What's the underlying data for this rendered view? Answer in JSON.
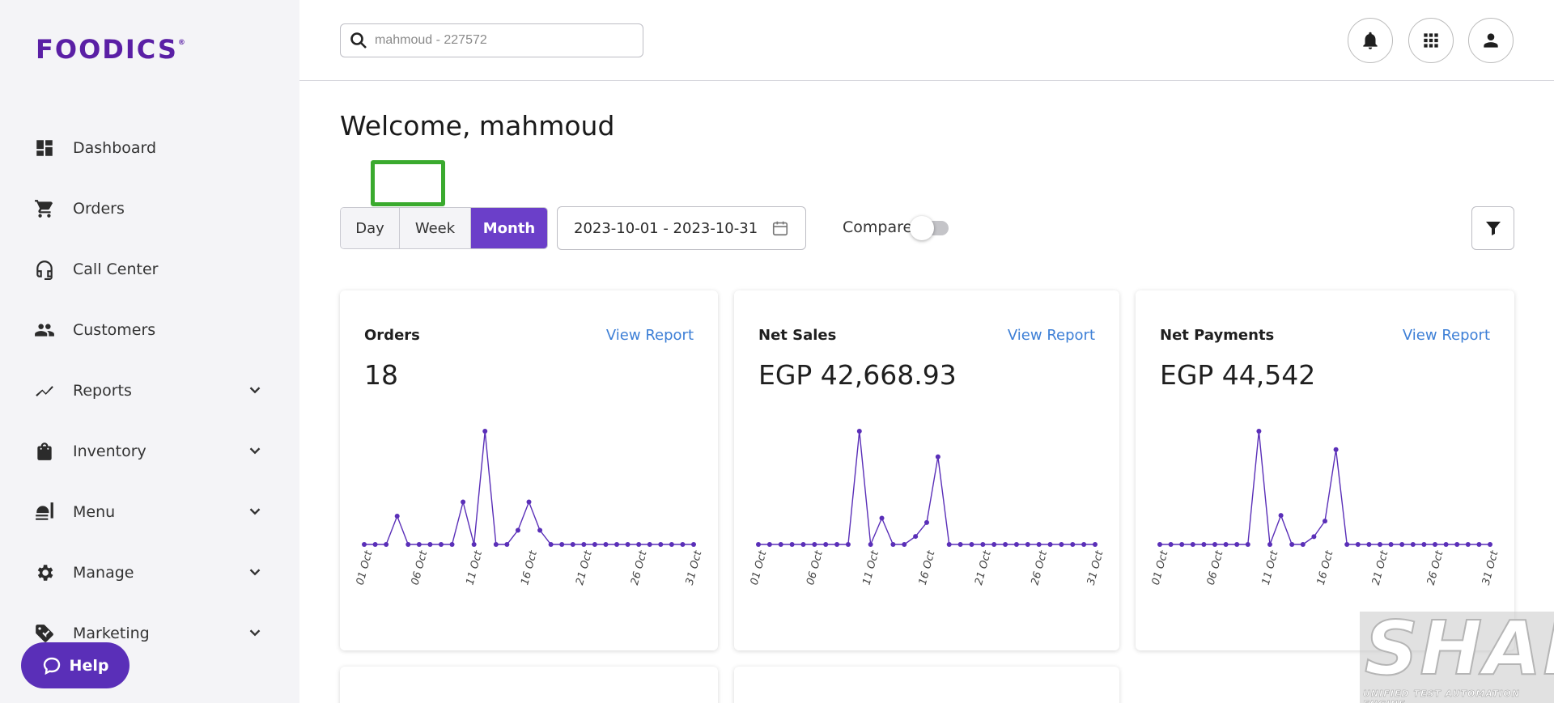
{
  "brand": {
    "logo_text": "FOODICS",
    "logo_mark": "®",
    "accent": "#6b3fc9"
  },
  "sidebar": {
    "items": [
      {
        "label": "Dashboard",
        "icon": "dashboard-icon",
        "expandable": false
      },
      {
        "label": "Orders",
        "icon": "cart-icon",
        "expandable": false
      },
      {
        "label": "Call Center",
        "icon": "headset-icon",
        "expandable": false
      },
      {
        "label": "Customers",
        "icon": "people-icon",
        "expandable": false
      },
      {
        "label": "Reports",
        "icon": "trend-icon",
        "expandable": true
      },
      {
        "label": "Inventory",
        "icon": "bag-icon",
        "expandable": true
      },
      {
        "label": "Menu",
        "icon": "menu-food-icon",
        "expandable": true
      },
      {
        "label": "Manage",
        "icon": "gear-icon",
        "expandable": true
      },
      {
        "label": "Marketing",
        "icon": "tag-icon",
        "expandable": true
      }
    ],
    "help_label": "Help"
  },
  "header": {
    "search_placeholder": "mahmoud - 227572"
  },
  "main": {
    "welcome": "Welcome, mahmoud",
    "period_tabs": [
      {
        "label": "Day",
        "active": false
      },
      {
        "label": "Week",
        "active": false
      },
      {
        "label": "Month",
        "active": true
      }
    ],
    "date_range": "2023-10-01 - 2023-10-31",
    "compare_label": "Compare",
    "compare_on": false,
    "cards": [
      {
        "title": "Orders",
        "link": "View Report",
        "value": "18"
      },
      {
        "title": "Net Sales",
        "link": "View Report",
        "value": "EGP 42,668.93"
      },
      {
        "title": "Net Payments",
        "link": "View Report",
        "value": "EGP 44,542"
      }
    ]
  },
  "watermark": {
    "title": "SHAFT",
    "subtitle": "UNIFIED TEST AUTOMATION ENGINE"
  },
  "chart_data": [
    {
      "type": "line",
      "title": "Orders",
      "x": [
        "01 Oct",
        "02 Oct",
        "03 Oct",
        "04 Oct",
        "05 Oct",
        "06 Oct",
        "07 Oct",
        "08 Oct",
        "09 Oct",
        "10 Oct",
        "11 Oct",
        "12 Oct",
        "13 Oct",
        "14 Oct",
        "15 Oct",
        "16 Oct",
        "17 Oct",
        "18 Oct",
        "19 Oct",
        "20 Oct",
        "21 Oct",
        "22 Oct",
        "23 Oct",
        "24 Oct",
        "25 Oct",
        "26 Oct",
        "27 Oct",
        "28 Oct",
        "29 Oct",
        "30 Oct",
        "31 Oct"
      ],
      "tick_labels": [
        "01 Oct",
        "06 Oct",
        "11 Oct",
        "16 Oct",
        "21 Oct",
        "26 Oct",
        "31 Oct"
      ],
      "series": [
        {
          "color": "#5a2fb8",
          "values": [
            0,
            0,
            0,
            2,
            0,
            0,
            0,
            0,
            0,
            3,
            0,
            8,
            0,
            0,
            1,
            3,
            1,
            0,
            0,
            0,
            0,
            0,
            0,
            0,
            0,
            0,
            0,
            0,
            0,
            0,
            0
          ]
        }
      ]
    },
    {
      "type": "line",
      "title": "Net Sales",
      "x": [
        "01 Oct",
        "02 Oct",
        "03 Oct",
        "04 Oct",
        "05 Oct",
        "06 Oct",
        "07 Oct",
        "08 Oct",
        "09 Oct",
        "10 Oct",
        "11 Oct",
        "12 Oct",
        "13 Oct",
        "14 Oct",
        "15 Oct",
        "16 Oct",
        "17 Oct",
        "18 Oct",
        "19 Oct",
        "20 Oct",
        "21 Oct",
        "22 Oct",
        "23 Oct",
        "24 Oct",
        "25 Oct",
        "26 Oct",
        "27 Oct",
        "28 Oct",
        "29 Oct",
        "30 Oct",
        "31 Oct"
      ],
      "tick_labels": [
        "01 Oct",
        "06 Oct",
        "11 Oct",
        "16 Oct",
        "21 Oct",
        "26 Oct",
        "31 Oct"
      ],
      "series": [
        {
          "color": "#5a2fb8",
          "values": [
            0,
            0,
            0,
            0,
            0,
            0,
            0,
            0,
            0,
            15500,
            0,
            3600,
            0,
            0,
            1100,
            3000,
            12000,
            0,
            0,
            0,
            0,
            0,
            0,
            0,
            0,
            0,
            0,
            0,
            0,
            0,
            0
          ]
        }
      ]
    },
    {
      "type": "line",
      "title": "Net Payments",
      "x": [
        "01 Oct",
        "02 Oct",
        "03 Oct",
        "04 Oct",
        "05 Oct",
        "06 Oct",
        "07 Oct",
        "08 Oct",
        "09 Oct",
        "10 Oct",
        "11 Oct",
        "12 Oct",
        "13 Oct",
        "14 Oct",
        "15 Oct",
        "16 Oct",
        "17 Oct",
        "18 Oct",
        "19 Oct",
        "20 Oct",
        "21 Oct",
        "22 Oct",
        "23 Oct",
        "24 Oct",
        "25 Oct",
        "26 Oct",
        "27 Oct",
        "28 Oct",
        "29 Oct",
        "30 Oct",
        "31 Oct"
      ],
      "tick_labels": [
        "01 Oct",
        "06 Oct",
        "11 Oct",
        "16 Oct",
        "21 Oct",
        "26 Oct",
        "31 Oct"
      ],
      "series": [
        {
          "color": "#5a2fb8",
          "values": [
            0,
            0,
            0,
            0,
            0,
            0,
            0,
            0,
            0,
            16000,
            0,
            4100,
            0,
            0,
            1100,
            3300,
            13400,
            0,
            0,
            0,
            0,
            0,
            0,
            0,
            0,
            0,
            0,
            0,
            0,
            0,
            0
          ]
        }
      ]
    }
  ]
}
